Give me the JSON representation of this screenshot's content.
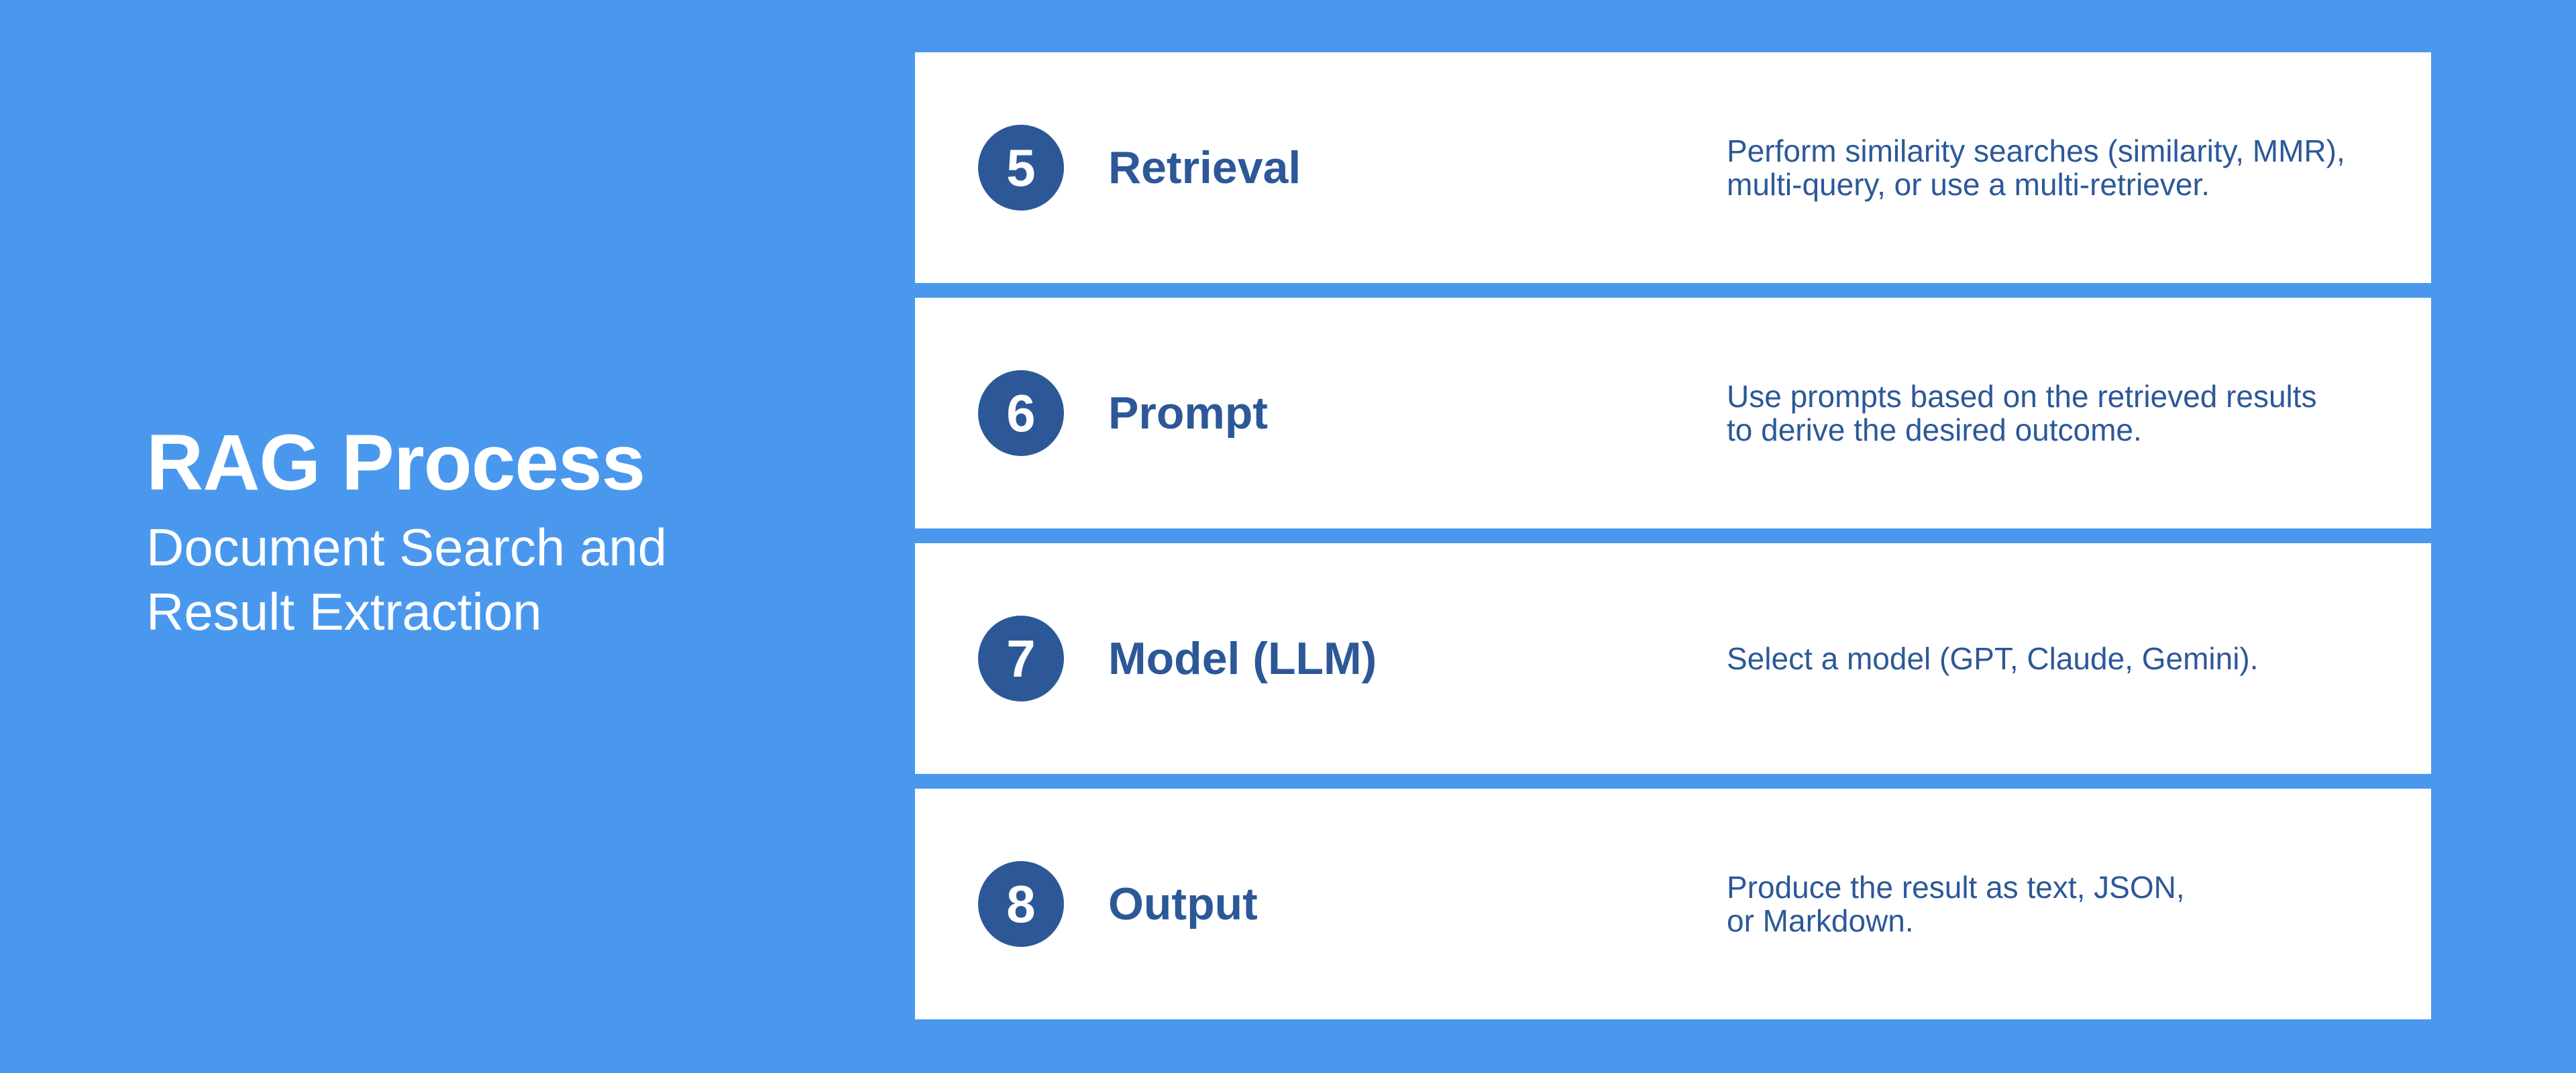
{
  "header": {
    "title": "RAG Process",
    "subtitle": "Document Search and\nResult Extraction"
  },
  "steps": [
    {
      "number": "5",
      "title": "Retrieval",
      "description": "Perform similarity searches (similarity, MMR),\nmulti-query, or use a multi-retriever."
    },
    {
      "number": "6",
      "title": "Prompt",
      "description": "Use prompts based on the retrieved results\nto derive the desired outcome."
    },
    {
      "number": "7",
      "title": "Model (LLM)",
      "description": "Select a model (GPT, Claude, Gemini)."
    },
    {
      "number": "8",
      "title": "Output",
      "description": "Produce the result as text, JSON,\nor Markdown."
    }
  ],
  "colors": {
    "background": "#4a98ee",
    "card": "#ffffff",
    "accent": "#2c5898",
    "header_text": "#ffffff"
  }
}
